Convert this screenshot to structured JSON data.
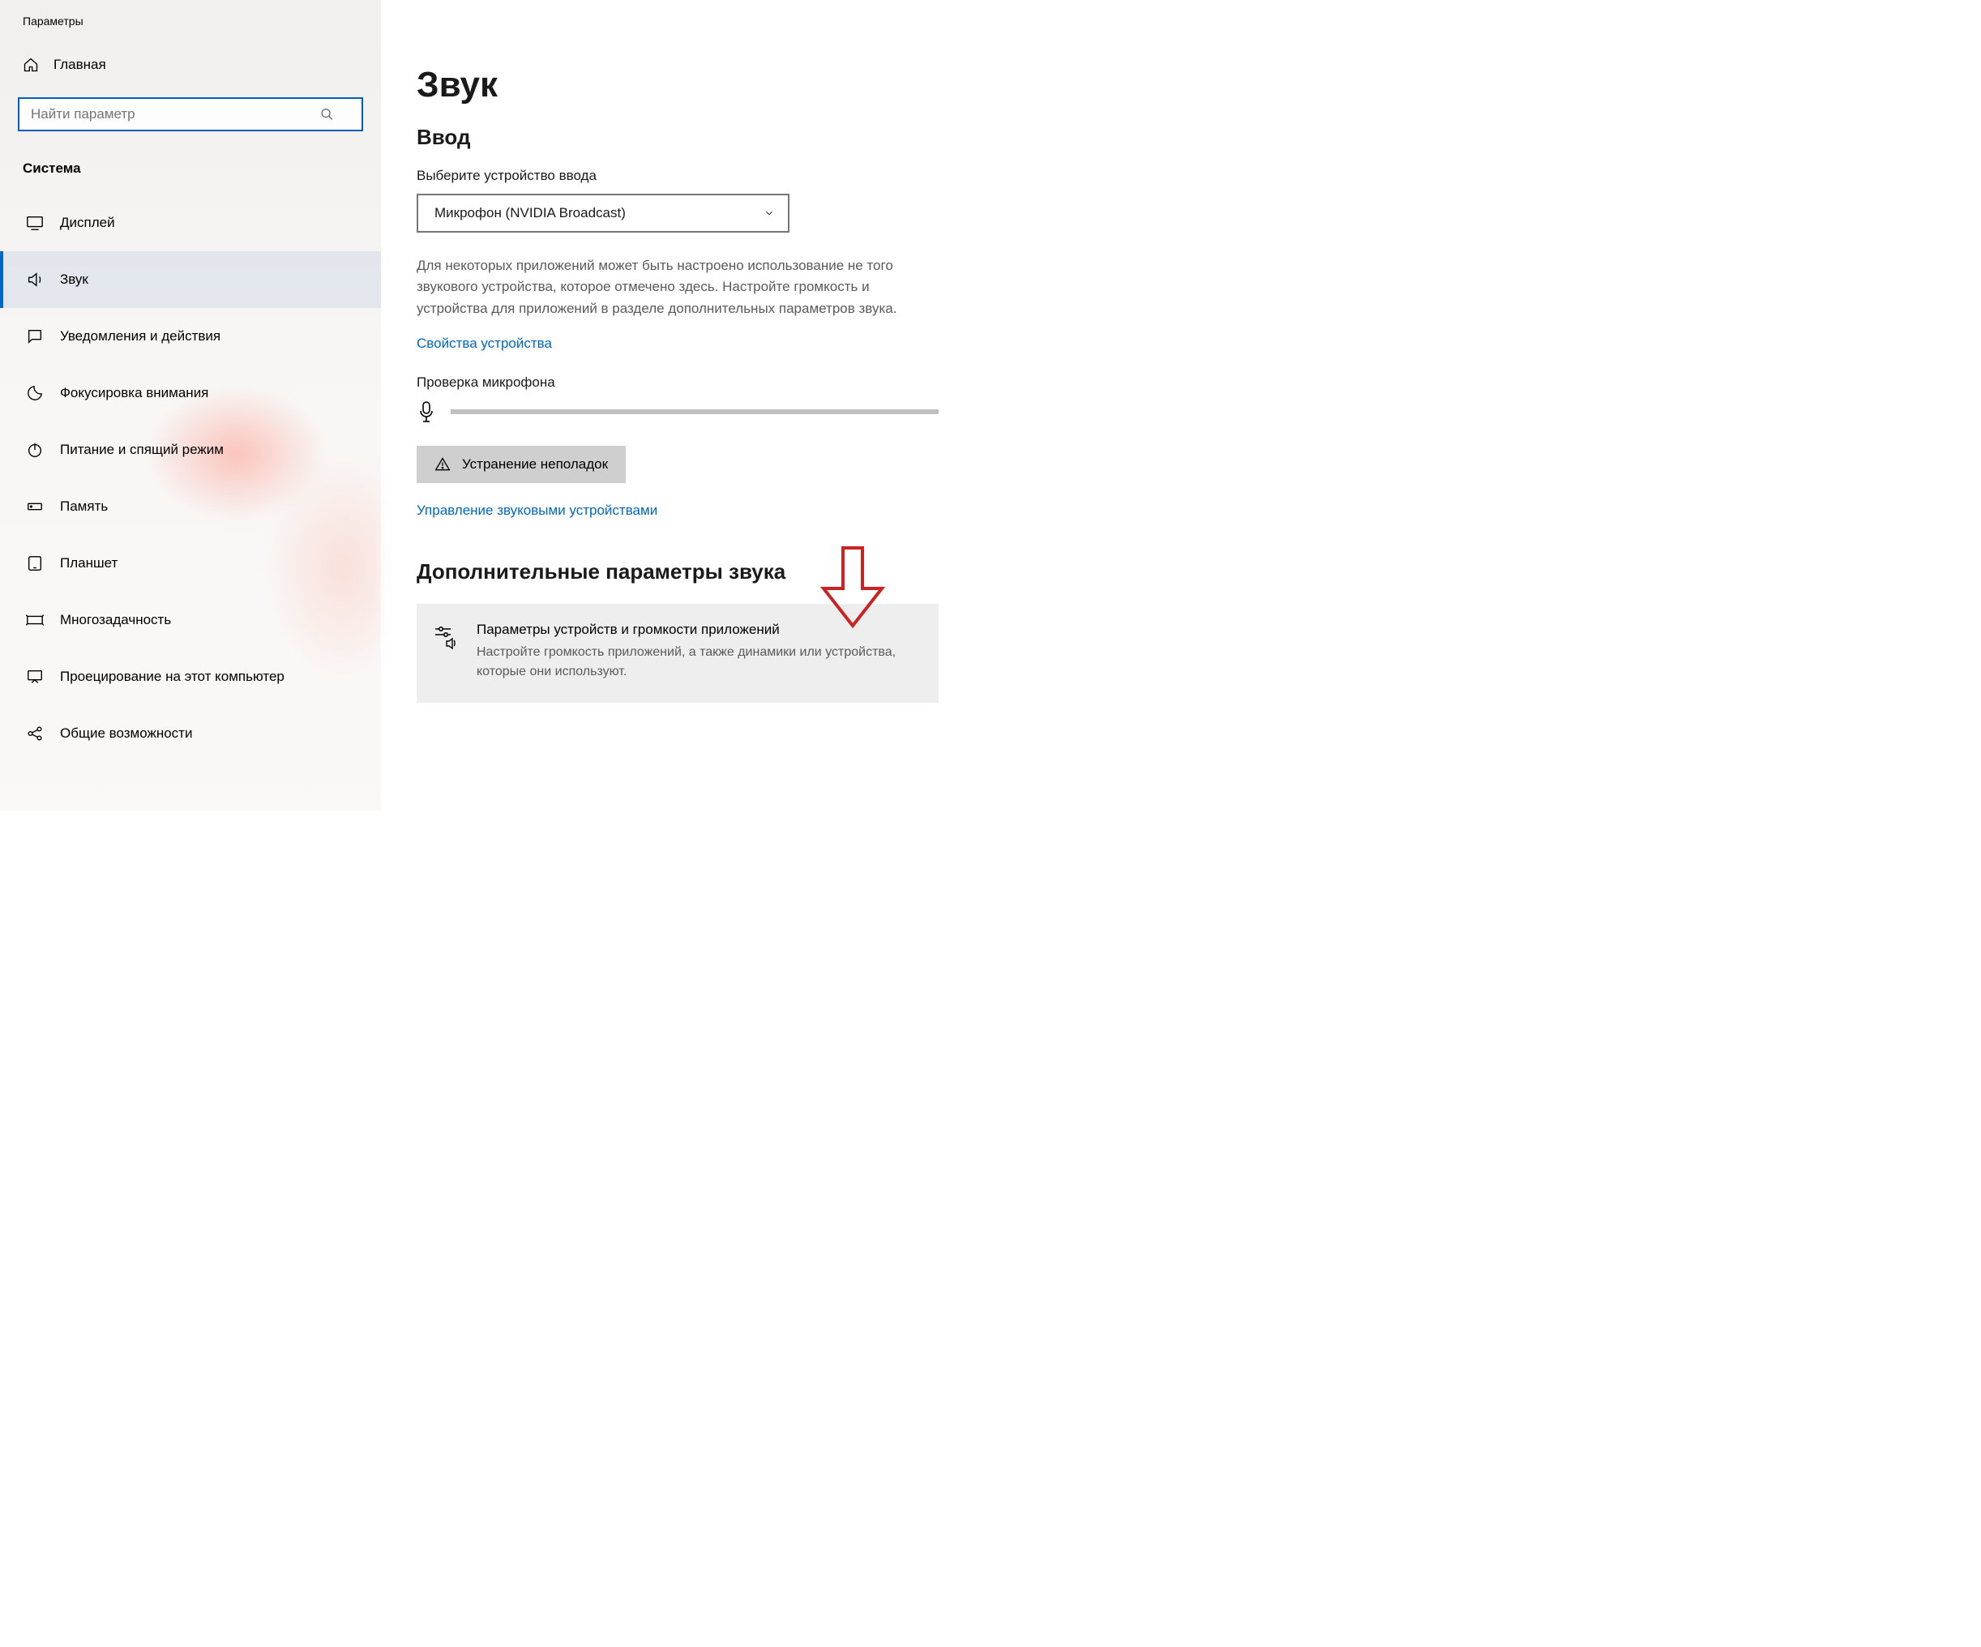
{
  "app": {
    "title": "Параметры"
  },
  "sidebar": {
    "home_label": "Главная",
    "search_placeholder": "Найти параметр",
    "section_label": "Система",
    "items": [
      {
        "label": "Дисплей",
        "icon": "display-icon"
      },
      {
        "label": "Звук",
        "icon": "sound-icon",
        "active": true
      },
      {
        "label": "Уведомления и действия",
        "icon": "notifications-icon"
      },
      {
        "label": "Фокусировка внимания",
        "icon": "moon-icon"
      },
      {
        "label": "Питание и спящий режим",
        "icon": "power-icon"
      },
      {
        "label": "Память",
        "icon": "storage-icon"
      },
      {
        "label": "Планшет",
        "icon": "tablet-icon"
      },
      {
        "label": "Многозадачность",
        "icon": "multitask-icon"
      },
      {
        "label": "Проецирование на этот компьютер",
        "icon": "project-icon"
      },
      {
        "label": "Общие возможности",
        "icon": "share-icon"
      }
    ]
  },
  "main": {
    "page_title": "Звук",
    "input_heading": "Ввод",
    "input_device_label": "Выберите устройство ввода",
    "input_device_value": "Микрофон (NVIDIA Broadcast)",
    "help_text": "Для некоторых приложений может быть настроено использование не того звукового устройства, которое отмечено здесь. Настройте громкость и устройства для приложений в разделе дополнительных параметров звука.",
    "device_properties_link": "Свойства устройства",
    "mic_test_label": "Проверка микрофона",
    "troubleshoot_label": "Устранение неполадок",
    "manage_devices_link": "Управление звуковыми устройствами",
    "extra_heading": "Дополнительные параметры звука",
    "tile": {
      "title": "Параметры устройств и громкости приложений",
      "desc": "Настройте громкость приложений, а также динамики или устройства, которые они используют."
    }
  }
}
